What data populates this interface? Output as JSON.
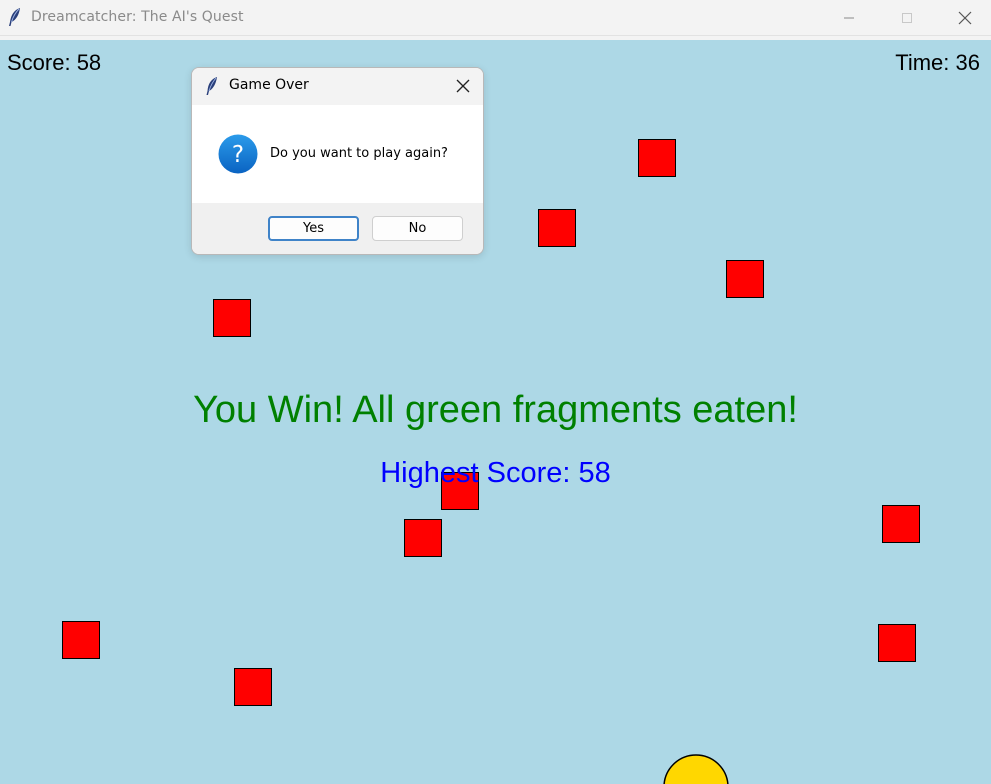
{
  "window": {
    "title": "Dreamcatcher: The AI's Quest",
    "icon": "feather-icon",
    "controls": [
      "minimize-icon",
      "maximize-icon",
      "close-icon"
    ]
  },
  "hud": {
    "score_label": "Score: 58",
    "time_label": "Time: 36"
  },
  "messages": {
    "win": "You Win! All green fragments eaten!",
    "high_score": "Highest Score: 58"
  },
  "dialog": {
    "title": "Game Over",
    "icon": "question-icon",
    "message": "Do you want to play again?",
    "yes_label": "Yes",
    "no_label": "No"
  },
  "colors": {
    "background": "#add8e6",
    "obstacle": "#ff0000",
    "win_text": "#008000",
    "high_score_text": "#0000ff",
    "player": "#ffd700"
  },
  "obstacles_count": 11
}
